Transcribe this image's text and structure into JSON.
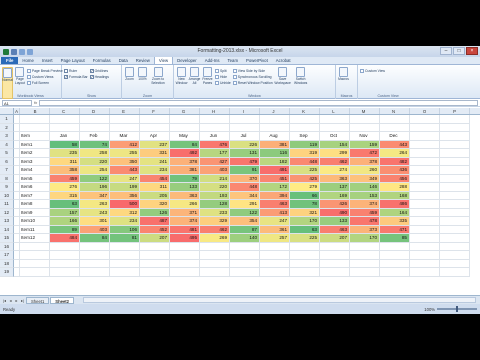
{
  "window": {
    "title": "Formatting-2013.xlsx - Microsoft Excel"
  },
  "ribbon_tabs": [
    "File",
    "Home",
    "Insert",
    "Page Layout",
    "Formulas",
    "Data",
    "Review",
    "View",
    "Developer",
    "Add-Ins",
    "Team",
    "PowerPivot",
    "Acrobat"
  ],
  "active_tab": "View",
  "ribbon": {
    "workbook_views": {
      "label": "Workbook Views",
      "normal": "Normal",
      "page_layout": "Page Layout",
      "small": [
        "Page Break Preview",
        "Custom Views",
        "Full Screen"
      ]
    },
    "show": {
      "label": "Show",
      "items": [
        {
          "text": "Ruler",
          "checked": false
        },
        {
          "text": "Formula Bar",
          "checked": true
        },
        {
          "text": "Gridlines",
          "checked": true
        },
        {
          "text": "Headings",
          "checked": true
        }
      ]
    },
    "zoom": {
      "label": "Zoom",
      "buttons": [
        "Zoom",
        "100%",
        "Zoom to Selection"
      ]
    },
    "window": {
      "label": "Window",
      "buttons": [
        "New Window",
        "Arrange All",
        "Freeze Panes"
      ],
      "small": [
        "Split",
        "Hide",
        "Unhide",
        "View Side by Side",
        "Synchronous Scrolling",
        "Reset Window Position"
      ],
      "save": "Save Workspace",
      "switch": "Switch Windows"
    },
    "macros": {
      "label": "Macros",
      "button": "Macros"
    },
    "custom": {
      "label": "Custom View",
      "button": "Custom View"
    }
  },
  "formula_bar": {
    "name_box": "A1",
    "fx": "fx",
    "value": ""
  },
  "columns": [
    "A",
    "B",
    "C",
    "D",
    "E",
    "F",
    "G",
    "H",
    "I",
    "J",
    "K",
    "L",
    "M",
    "N",
    "O",
    "P"
  ],
  "header_row": {
    "row": "3",
    "item": "Item",
    "months": [
      "Jan",
      "Feb",
      "Mar",
      "Apr",
      "May",
      "Jun",
      "Jul",
      "Aug",
      "Sep",
      "Oct",
      "Nov",
      "Dec"
    ]
  },
  "rows": [
    {
      "n": "4",
      "item": "Item1",
      "values": [
        58,
        74,
        412,
        237,
        84,
        476,
        226,
        381,
        119,
        154,
        159,
        443
      ]
    },
    {
      "n": "5",
      "item": "Item2",
      "values": [
        235,
        258,
        255,
        331,
        492,
        177,
        131,
        116,
        319,
        299,
        472,
        264
      ]
    },
    {
      "n": "6",
      "item": "Item3",
      "values": [
        311,
        220,
        350,
        241,
        378,
        427,
        479,
        182,
        448,
        462,
        378,
        482
      ]
    },
    {
      "n": "7",
      "item": "Item4",
      "values": [
        358,
        254,
        443,
        234,
        381,
        403,
        91,
        491,
        225,
        274,
        260,
        436
      ]
    },
    {
      "n": "8",
      "item": "Item5",
      "values": [
        459,
        122,
        247,
        454,
        79,
        214,
        370,
        451,
        425,
        363,
        349,
        456
      ]
    },
    {
      "n": "9",
      "item": "Item6",
      "values": [
        276,
        196,
        199,
        311,
        133,
        220,
        448,
        172,
        279,
        137,
        146,
        288
      ]
    },
    {
      "n": "10",
      "item": "Item7",
      "values": [
        315,
        347,
        356,
        205,
        363,
        193,
        344,
        394,
        66,
        169,
        153,
        168
      ]
    },
    {
      "n": "11",
      "item": "Item8",
      "values": [
        63,
        263,
        500,
        320,
        266,
        128,
        291,
        463,
        78,
        426,
        374,
        486
      ]
    },
    {
      "n": "12",
      "item": "Item9",
      "values": [
        157,
        243,
        312,
        126,
        371,
        233,
        122,
        413,
        321,
        490,
        459,
        164
      ]
    },
    {
      "n": "13",
      "item": "Item10",
      "values": [
        166,
        301,
        234,
        487,
        374,
        329,
        354,
        247,
        170,
        133,
        478,
        335
      ]
    },
    {
      "n": "14",
      "item": "Item11",
      "values": [
        89,
        403,
        106,
        452,
        481,
        462,
        87,
        361,
        63,
        463,
        373,
        471
      ]
    },
    {
      "n": "15",
      "item": "Item12",
      "values": [
        484,
        84,
        81,
        207,
        495,
        269,
        140,
        257,
        225,
        207,
        170,
        85
      ]
    }
  ],
  "blank_rows": [
    "1",
    "2",
    "16",
    "17",
    "18",
    "19"
  ],
  "color_scale": {
    "low": "#63be7b",
    "mid": "#ffeb84",
    "high": "#f8696b",
    "min": 58,
    "max": 500
  },
  "sheets": [
    "Sheet1",
    "Sheet2"
  ],
  "active_sheet": "Sheet2",
  "status": {
    "left": "Ready",
    "zoom": "100%"
  }
}
